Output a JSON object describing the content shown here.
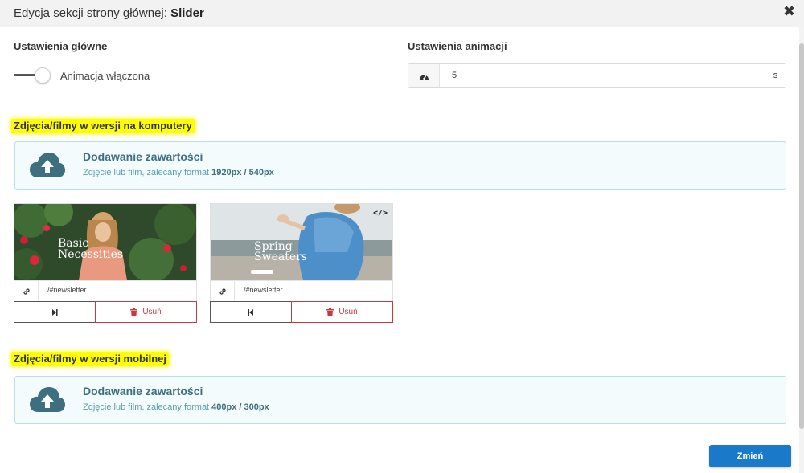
{
  "header": {
    "title_prefix": "Edycja sekcji strony głównej: ",
    "title_strong": "Slider",
    "close_symbol": "✖"
  },
  "main_settings": {
    "label": "Ustawienia główne",
    "toggle_label": "Animacja włączona",
    "toggle_on": true
  },
  "animation_settings": {
    "label": "Ustawienia animacji",
    "value": "5",
    "unit": "s",
    "icon": "speedometer-icon"
  },
  "desktop": {
    "heading": "Zdjęcia/filmy w wersji na komputery",
    "upload": {
      "title": "Dodawanie zawartości",
      "subtitle_prefix": "Zdjęcie lub film, zalecany format ",
      "subtitle_format": "1920px / 540px"
    },
    "slides": [
      {
        "image_text_line1": "Basic",
        "image_text_line2": "Necessities",
        "link": "/#newsletter",
        "delete_label": "Usuń",
        "move_icon": "skip-forward-icon"
      },
      {
        "image_text_line1": "Spring",
        "image_text_line2": "Sweaters",
        "link": "/#newsletter",
        "delete_label": "Usuń",
        "move_icon": "skip-back-icon",
        "badge": "</>"
      }
    ]
  },
  "mobile": {
    "heading": "Zdjęcia/filmy w wersji mobilnej",
    "upload": {
      "title": "Dodawanie zawartości",
      "subtitle_prefix": "Zdjęcie lub film, zalecany format ",
      "subtitle_format": "400px / 300px"
    }
  },
  "footer": {
    "submit_label": "Zmień"
  },
  "colors": {
    "primary": "#1a7ac9",
    "danger": "#c9373f",
    "upload_accent": "#3d6f7f",
    "highlight": "#ffff00"
  }
}
